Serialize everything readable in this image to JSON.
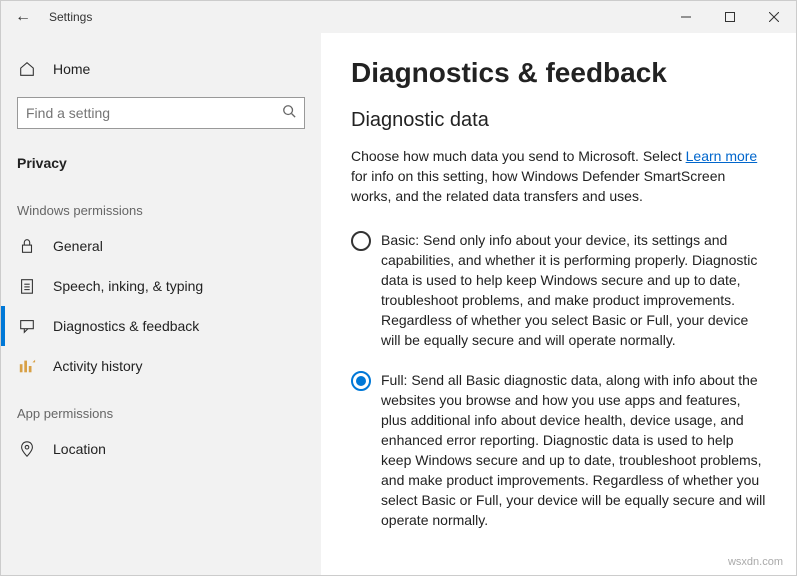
{
  "titlebar": {
    "title": "Settings"
  },
  "sidebar": {
    "home_label": "Home",
    "search_placeholder": "Find a setting",
    "category": "Privacy",
    "section_windows": "Windows permissions",
    "items": {
      "general": "General",
      "speech": "Speech, inking, & typing",
      "diagnostics": "Diagnostics & feedback",
      "activity": "Activity history"
    },
    "section_app": "App permissions",
    "app_items": {
      "location": "Location"
    }
  },
  "main": {
    "page_title": "Diagnostics & feedback",
    "subheading": "Diagnostic data",
    "intro_pre": "Choose how much data you send to Microsoft. Select  ",
    "learn_more": "Learn more",
    "intro_post": "  for info on this setting, how Windows Defender SmartScreen works, and the related data transfers and uses.",
    "option_basic": "Basic: Send only info about your device, its settings and capabilities, and whether it is performing properly. Diagnostic data is used to help keep Windows secure and up to date, troubleshoot problems, and make product improvements. Regardless of whether you select Basic or Full, your device will be equally secure and will operate normally.",
    "option_full": "Full: Send all Basic diagnostic data, along with info about the websites you browse and how you use apps and features, plus additional info about device health, device usage, and enhanced error reporting. Diagnostic data is used to help keep Windows secure and up to date, troubleshoot problems, and make product improvements. Regardless of whether you select Basic or Full, your device will be equally secure and will operate normally.",
    "selected": "full"
  },
  "watermark": "wsxdn.com"
}
